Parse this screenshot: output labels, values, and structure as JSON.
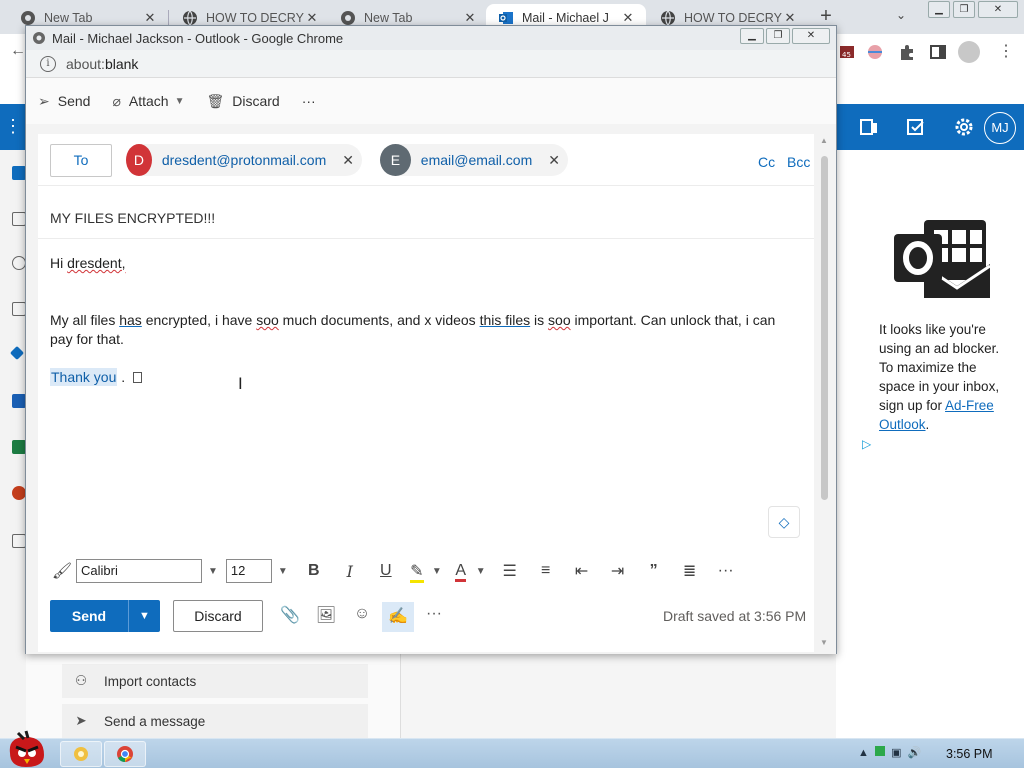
{
  "browser": {
    "tabs": [
      {
        "title": "New Tab",
        "active": false
      },
      {
        "title": "HOW TO DECRY",
        "active": false
      },
      {
        "title": "New Tab",
        "active": false
      },
      {
        "title": "Mail - Michael J",
        "active": true
      },
      {
        "title": "HOW TO DECRY",
        "active": false
      }
    ],
    "new_tab_glyph": "+",
    "tab_search_glyph": "⌄"
  },
  "popup": {
    "window_title": "Mail - Michael Jackson - Outlook - Google Chrome",
    "url_prefix": "about:",
    "url_main": "blank"
  },
  "compose": {
    "command_bar": {
      "send": "Send",
      "attach": "Attach",
      "discard": "Discard",
      "more": "···"
    },
    "to_label": "To",
    "recipients": [
      {
        "initial": "D",
        "email": "dresdent@protonmail.com",
        "color": "#d13438"
      },
      {
        "initial": "E",
        "email": "email@email.com",
        "color": "#5f6a72"
      }
    ],
    "cc_label": "Cc",
    "bcc_label": "Bcc",
    "subject": "MY FILES ENCRYPTED!!!",
    "body": {
      "greeting_hi": "Hi",
      "greeting_name": "dresdent,",
      "para": {
        "p1": "My all files ",
        "has": "has",
        "p2": " encrypted, i have ",
        "soo1": "soo",
        "p3": " much documents, and x videos ",
        "this_files": "this files",
        "p4": " is ",
        "soo2": "soo",
        "p5": " important. Can unlock that, i can pay for that."
      },
      "thank_you": "Thank you",
      "thank_tail": " ."
    },
    "toolbar": {
      "font_name": "Calibri",
      "font_size": "12"
    },
    "actions": {
      "send": "Send",
      "discard": "Discard",
      "more": "···",
      "draft_status": "Draft saved at 3:56 PM"
    }
  },
  "outlook_bg": {
    "avatar_initials": "MJ",
    "adblock_text": "It looks like you're using an ad blocker. To maximize the space in your inbox, sign up for ",
    "adblock_link": "Ad-Free Outlook",
    "adblock_end": ".",
    "import_contacts": "Import contacts",
    "send_message": "Send a message",
    "brand_color": "#0f6cbd"
  },
  "taskbar": {
    "clock": "3:56 PM"
  }
}
